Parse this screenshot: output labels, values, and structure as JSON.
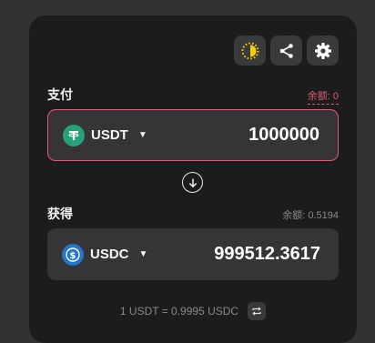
{
  "toolbar": {
    "icons": [
      "refresh-timer-icon",
      "share-icon",
      "settings-gear-icon"
    ]
  },
  "pay": {
    "label": "支付",
    "balance": "余额: 0",
    "token": "USDT",
    "amount": "1000000",
    "token_icon": "tether-icon",
    "token_color": "#26a17b"
  },
  "receive": {
    "label": "获得",
    "balance": "余额: 0.5194",
    "token": "USDC",
    "amount": "999512.3617",
    "token_icon": "usdc-icon",
    "token_color": "#2775ca"
  },
  "rate": {
    "text": "1 USDT = 0.9995 USDC"
  },
  "colors": {
    "accent_error": "#e05a76",
    "timer_yellow": "#f4d000"
  }
}
